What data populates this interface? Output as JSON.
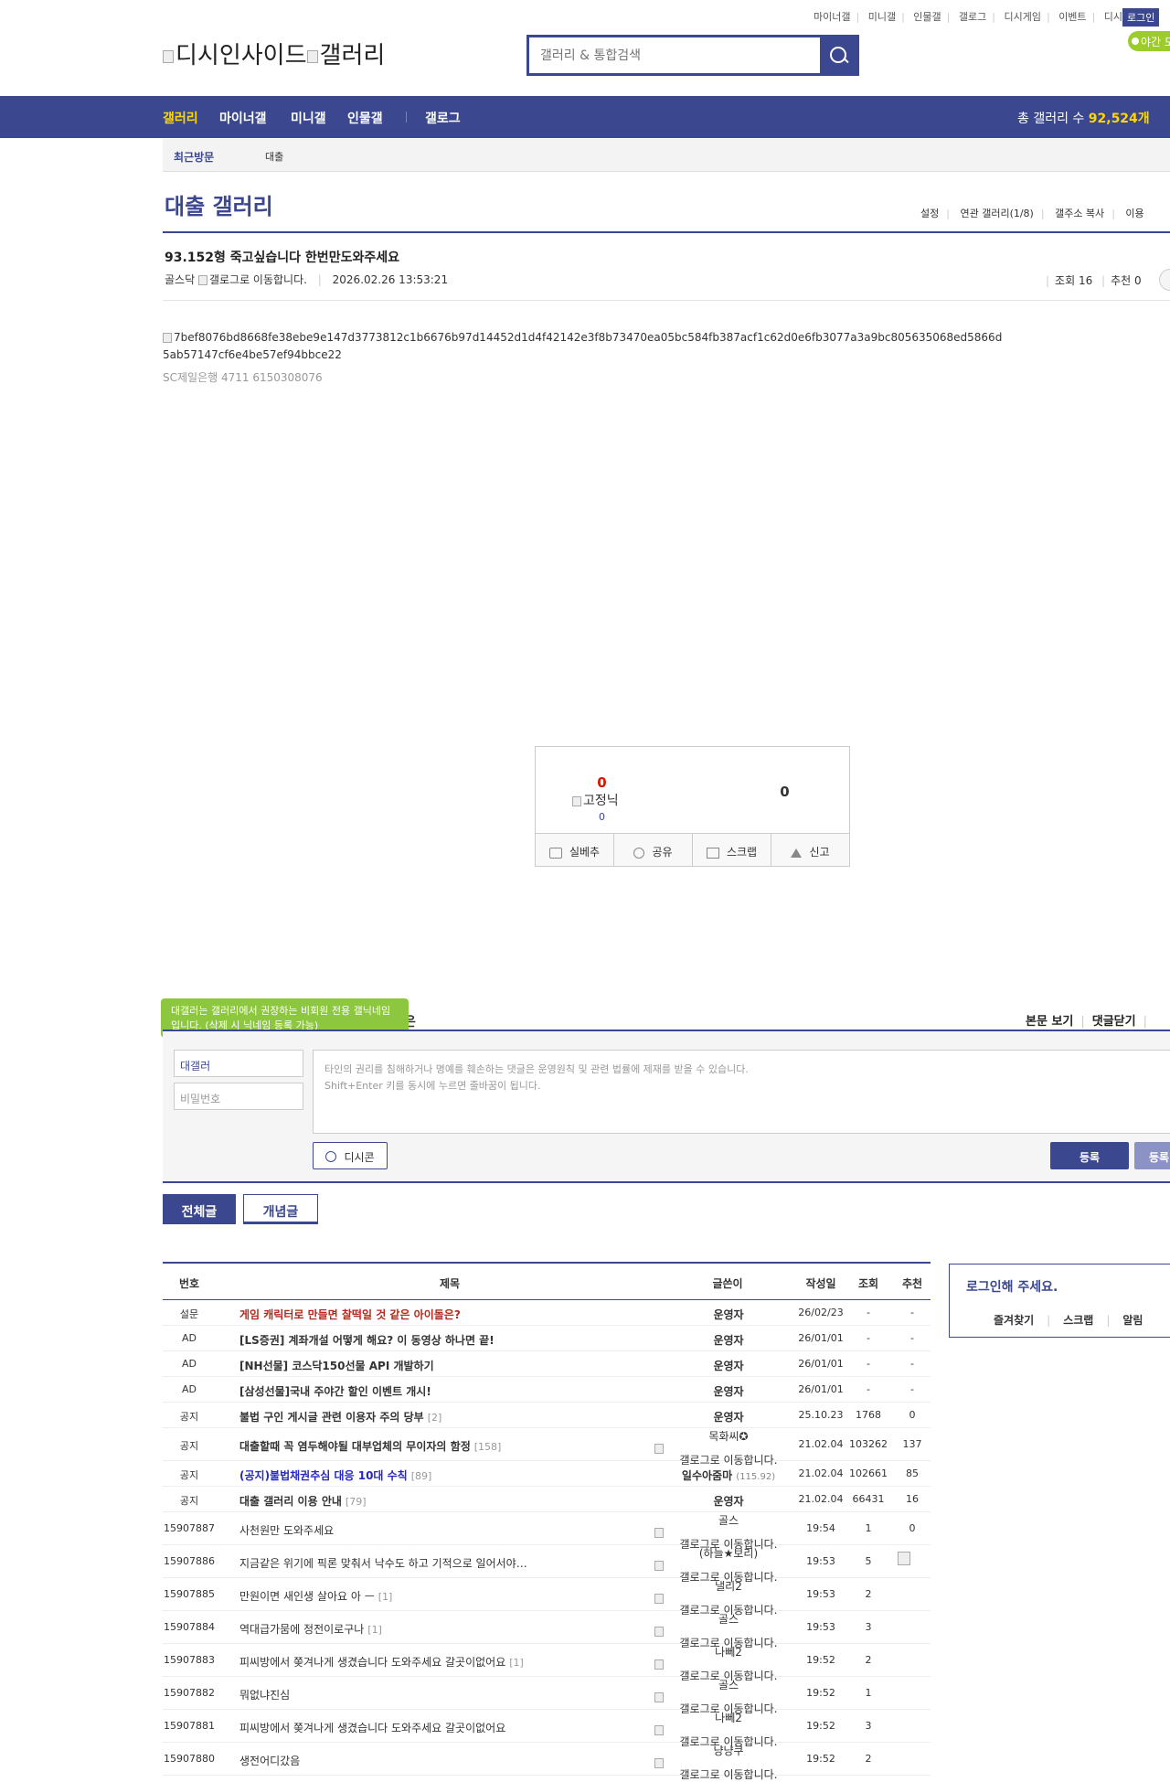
{
  "util_links": [
    "마이너갤",
    "미니갤",
    "인물갤",
    "갤로그",
    "디시게임",
    "이벤트",
    "디시콘"
  ],
  "login_label": "로그인",
  "night_label": "야간 모드",
  "logo": {
    "part1": "디시인사이드",
    "part2": "갤러리"
  },
  "search": {
    "placeholder": "갤러리 & 통합검색"
  },
  "nav": {
    "items": [
      "갤러리",
      "마이너갤",
      "미니갤",
      "인물갤",
      "갤로그"
    ],
    "total_label": "총 갤러리 수",
    "total_value": "92,524개"
  },
  "recent": {
    "label": "최근방문",
    "item": "대출"
  },
  "gallery": {
    "title": "대출 갤러리",
    "links": [
      "설정",
      "연관 갤러리(1/8)",
      "갤주소 복사",
      "이용"
    ]
  },
  "post": {
    "title": "93.152형 죽고싶습니다 한번만도와주세요",
    "author": "골스닥",
    "gallog_alt": "갤로그로 이동합니다.",
    "date": "2026.02.26 13:53:21",
    "views": "조회 16",
    "recommend": "추천 0",
    "image_alt": "7bef8076bd8668fe38ebe9e147d3773812c1b6676b97d14452d1d4f42142e3f8b73470ea05bc584fb387acf1c62d0e6fb3077a3a9bc805635068ed5866d5ab57147cf6e4be57ef94bbce22",
    "bank": "SC제일은행 4711 6150308076"
  },
  "rec": {
    "up": "0",
    "fixnick": "고정닉",
    "fix_count": "0",
    "down": "0",
    "buttons": [
      "실베추",
      "공유",
      "스크랩",
      "신고"
    ]
  },
  "comment": {
    "tooltip": "대갤러는 갤러리에서 권장하는 비회원 전용 갤닉네임입니다. (삭제 시 닉네임 등록 가능)",
    "label_stub": "은",
    "tools": [
      "본문 보기",
      "댓글닫기"
    ],
    "nick_value": "대갤러",
    "pw_placeholder": "비밀번호",
    "textarea_line1": "타인의 권리를 침해하거나 명예를 훼손하는 댓글은 운영원칙 및 관련 법률에 제재를 받을 수 있습니다.",
    "textarea_line2": "Shift+Enter 키를 동시에 누르면 줄바꿈이 됩니다.",
    "dccon": "디시콘",
    "register": "등록",
    "register2": "등록+추천"
  },
  "tabs": {
    "all": "전체글",
    "concept": "개념글"
  },
  "table": {
    "headers": {
      "num": "번호",
      "title": "제목",
      "writer": "글쓴이",
      "date": "작성일",
      "views": "조회",
      "rec": "추천"
    },
    "rows": [
      {
        "num": "설문",
        "title": "게임 캐릭터로 만들면 찰떡일 것 같은 아이돌은?",
        "replies": "",
        "writer": "운영자",
        "writer2": "",
        "ip": "",
        "date": "26/02/23",
        "views": "-",
        "rec": "-"
      },
      {
        "num": "AD",
        "title": "[LS증권] 계좌개설 어떻게 해요? 이 동영상 하나면 끝!",
        "replies": "",
        "writer": "운영자",
        "writer2": "",
        "ip": "",
        "date": "26/01/01",
        "views": "-",
        "rec": "-"
      },
      {
        "num": "AD",
        "title": "[NH선물] 코스닥150선물 API 개발하기",
        "replies": "",
        "writer": "운영자",
        "writer2": "",
        "ip": "",
        "date": "26/01/01",
        "views": "-",
        "rec": "-"
      },
      {
        "num": "AD",
        "title": "[삼성선물]국내 주야간 할인 이벤트 개시!",
        "replies": "",
        "writer": "운영자",
        "writer2": "",
        "ip": "",
        "date": "26/01/01",
        "views": "-",
        "rec": "-"
      },
      {
        "num": "공지",
        "title": "불법 구인 게시글 관련 이용자 주의 당부",
        "replies": "[2]",
        "writer": "운영자",
        "writer2": "",
        "ip": "",
        "date": "25.10.23",
        "views": "1768",
        "rec": "0"
      },
      {
        "num": "공지",
        "title": "대출할때 꼭 염두해야될 대부업체의 무이자의 함정",
        "replies": "[158]",
        "writer": "목화씨✪",
        "writer2": "갤로그로 이동합니다.",
        "ip": "",
        "date": "21.02.04",
        "views": "103262",
        "rec": "137"
      },
      {
        "num": "공지",
        "title": "(공지)불법채권추심 대응 10대 수칙",
        "replies": "[89]",
        "writer": "일수아줌마",
        "writer2": "",
        "ip": "(115.92)",
        "date": "21.02.04",
        "views": "102661",
        "rec": "85"
      },
      {
        "num": "공지",
        "title": "대출 갤러리 이용 안내",
        "replies": "[79]",
        "writer": "운영자",
        "writer2": "",
        "ip": "",
        "date": "21.02.04",
        "views": "66431",
        "rec": "16"
      },
      {
        "num": "15907887",
        "title": "사천원만 도와주세요",
        "replies": "",
        "writer": "골스",
        "writer2": "갤로그로 이동합니다.",
        "ip": "",
        "date": "19:54",
        "views": "1",
        "rec": "0"
      },
      {
        "num": "15907886",
        "title": "지금같은 위기에 픽론 맞춰서 낙수도 하고 기적으로 일어서야…",
        "replies": "",
        "writer": "(하늘★보리)",
        "writer2": "갤로그로 이동합니다.",
        "ip": "",
        "date": "19:53",
        "views": "5",
        "rec": ""
      },
      {
        "num": "15907885",
        "title": "만원이면 새인생 살아요 아 ㅡ",
        "replies": "[1]",
        "writer": "낼리2",
        "writer2": "갤로그로 이동합니다.",
        "ip": "",
        "date": "19:53",
        "views": "2",
        "rec": ""
      },
      {
        "num": "15907884",
        "title": "역대급가뭄에 정전이로구나",
        "replies": "[1]",
        "writer": "골스",
        "writer2": "갤로그로 이동합니다.",
        "ip": "",
        "date": "19:53",
        "views": "3",
        "rec": ""
      },
      {
        "num": "15907883",
        "title": "피씨방에서 쫒겨나게 생겼습니다 도와주세요 갈곳이없어요",
        "replies": "[1]",
        "writer": "나뻬2",
        "writer2": "갤로그로 이동합니다.",
        "ip": "",
        "date": "19:52",
        "views": "2",
        "rec": ""
      },
      {
        "num": "15907882",
        "title": "뭐없냐진심",
        "replies": "",
        "writer": "골스",
        "writer2": "갤로그로 이동합니다.",
        "ip": "",
        "date": "19:52",
        "views": "1",
        "rec": ""
      },
      {
        "num": "15907881",
        "title": "피씨방에서 쫒겨나게 생겼습니다 도와주세요 갈곳이없어요",
        "replies": "",
        "writer": "나뻬2",
        "writer2": "갤로그로 이동합니다.",
        "ip": "",
        "date": "19:52",
        "views": "3",
        "rec": ""
      },
      {
        "num": "15907880",
        "title": "생전어디갔음",
        "replies": "",
        "writer": "냥냥쿠",
        "writer2": "갤로그로 이동합니다.",
        "ip": "",
        "date": "19:52",
        "views": "2",
        "rec": ""
      }
    ]
  },
  "side": {
    "title": "로그인해 주세요.",
    "links": [
      "즐겨찾기",
      "스크랩",
      "알림"
    ]
  }
}
